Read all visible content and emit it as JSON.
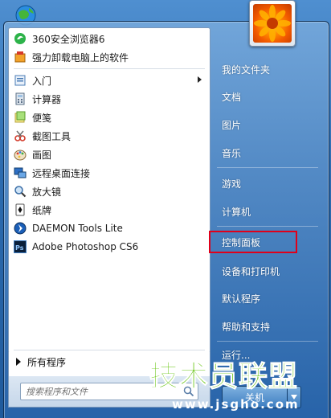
{
  "programs": [
    {
      "label": "360安全浏览器6",
      "icon": "browser-360-icon"
    },
    {
      "label": "强力卸载电脑上的软件",
      "icon": "uninstall-icon"
    },
    {
      "label": "入门",
      "icon": "getting-started-icon",
      "submenu": true
    },
    {
      "label": "计算器",
      "icon": "calculator-icon"
    },
    {
      "label": "便笺",
      "icon": "sticky-notes-icon"
    },
    {
      "label": "截图工具",
      "icon": "snipping-tool-icon"
    },
    {
      "label": "画图",
      "icon": "paint-icon"
    },
    {
      "label": "远程桌面连接",
      "icon": "remote-desktop-icon"
    },
    {
      "label": "放大镜",
      "icon": "magnifier-icon"
    },
    {
      "label": "纸牌",
      "icon": "solitaire-icon"
    },
    {
      "label": "DAEMON Tools Lite",
      "icon": "daemon-tools-icon"
    },
    {
      "label": "Adobe Photoshop CS6",
      "icon": "photoshop-icon"
    }
  ],
  "all_programs_label": "所有程序",
  "search": {
    "placeholder": "搜索程序和文件"
  },
  "right_pane": [
    {
      "label": "我的文件夹"
    },
    {
      "label": "文档"
    },
    {
      "label": "图片"
    },
    {
      "label": "音乐"
    },
    {
      "label": "游戏"
    },
    {
      "label": "计算机"
    },
    {
      "label": "控制面板"
    },
    {
      "label": "设备和打印机"
    },
    {
      "label": "默认程序"
    },
    {
      "label": "帮助和支持"
    },
    {
      "label": "运行..."
    }
  ],
  "shutdown_label": "关机",
  "watermark": {
    "text": "技术员联盟",
    "url": "www.jsgho.com"
  },
  "colors": {
    "highlight_border": "#e0001a",
    "watermark_green": "#5cc000"
  }
}
